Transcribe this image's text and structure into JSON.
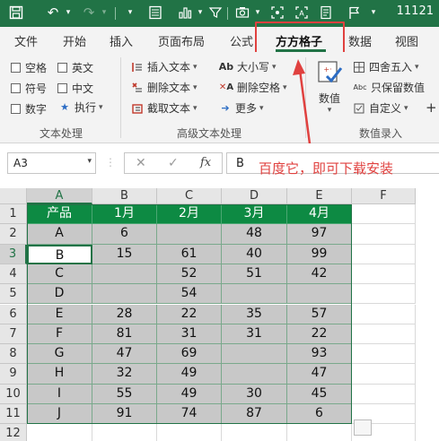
{
  "title_bar": {
    "right_text": "11121",
    "quick_access": [
      "save-icon",
      "undo-icon",
      "redo-icon",
      "format-painter-icon",
      "table-icon",
      "chart-icon",
      "filter-icon",
      "camera-icon",
      "screenshot-icon",
      "ocr-icon",
      "flag-icon"
    ]
  },
  "tabs": [
    {
      "label": "文件"
    },
    {
      "label": "开始"
    },
    {
      "label": "插入"
    },
    {
      "label": "页面布局"
    },
    {
      "label": "公式"
    },
    {
      "label": "方方格子"
    },
    {
      "label": "数据"
    },
    {
      "label": "视图"
    }
  ],
  "active_tab": "方方格子",
  "ribbon": {
    "text_processing": {
      "checkboxes": [
        "空格",
        "英文",
        "符号",
        "中文",
        "数字"
      ],
      "execute_label": "执行",
      "group_label": "文本处理"
    },
    "advanced_text": {
      "buttons": [
        "插入文本",
        "删除文本",
        "截取文本",
        "大小写",
        "删除空格",
        "更多"
      ],
      "group_label": "高级文本处理"
    },
    "numeric_entry": {
      "big_button": "数值",
      "buttons": [
        "四舍五入",
        "只保留数值",
        "自定义"
      ],
      "group_label": "数值录入",
      "add_icon": "+"
    }
  },
  "formula_bar": {
    "name_box": "A3",
    "formula_value": "B",
    "cancel": "✕",
    "confirm": "✓",
    "fx": "fx"
  },
  "annotation": {
    "text": "百度它，即可下载安装",
    "color": "#e0413f"
  },
  "sheet": {
    "columns": [
      "A",
      "B",
      "C",
      "D",
      "E",
      "F"
    ],
    "rows": [
      "1",
      "2",
      "3",
      "4",
      "5",
      "6",
      "7",
      "8",
      "9",
      "10",
      "11",
      "12"
    ],
    "selected_cell": "A3",
    "header_color": "#0d8a43",
    "body_color": "#c8c8c8",
    "table": [
      [
        "产品",
        "1月",
        "2月",
        "3月",
        "4月"
      ],
      [
        "A",
        "6",
        "",
        "48",
        "97"
      ],
      [
        "B",
        "15",
        "61",
        "40",
        "99"
      ],
      [
        "C",
        "",
        "52",
        "51",
        "42"
      ],
      [
        "D",
        "",
        "54",
        "",
        ""
      ],
      [
        "E",
        "28",
        "22",
        "35",
        "57"
      ],
      [
        "F",
        "81",
        "31",
        "31",
        "22"
      ],
      [
        "G",
        "47",
        "69",
        "",
        "93"
      ],
      [
        "H",
        "32",
        "49",
        "",
        "47"
      ],
      [
        "I",
        "55",
        "49",
        "30",
        "45"
      ],
      [
        "J",
        "91",
        "74",
        "87",
        "6"
      ]
    ]
  }
}
